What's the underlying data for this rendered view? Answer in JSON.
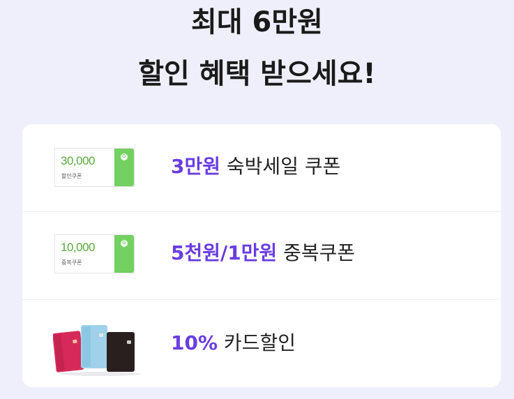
{
  "headline": {
    "line1": "최대 6만원",
    "line2": "할인 혜택 받으세요!"
  },
  "benefits": [
    {
      "coupon_amount": "30,000",
      "coupon_caption": "할인쿠폰",
      "coupon_mark": "G",
      "highlight": "3만원",
      "text": " 숙박세일 쿠폰"
    },
    {
      "coupon_amount": "10,000",
      "coupon_caption": "중복쿠폰",
      "coupon_mark": "G",
      "highlight": "5천원/1만원",
      "text": " 중복쿠폰"
    },
    {
      "highlight": "10%",
      "text": " 카드할인"
    }
  ],
  "colors": {
    "background": "#efeffb",
    "accent": "#6a3de0",
    "coupon_green": "#72d160"
  }
}
